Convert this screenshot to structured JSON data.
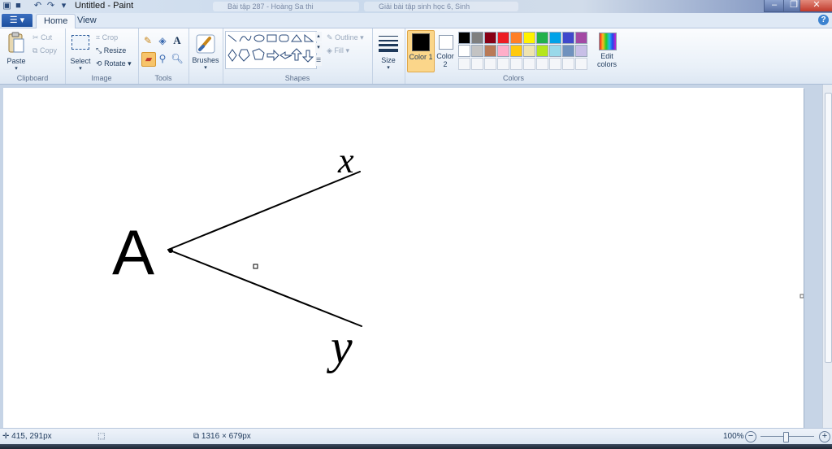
{
  "window": {
    "title": "Untitled - Paint",
    "background_tabs": [
      "Bài tập 287 - Hoàng Sa thi",
      "Giải bài tập sinh học 6, Sinh"
    ]
  },
  "tabs": {
    "home": "Home",
    "view": "View"
  },
  "ribbon": {
    "clipboard": {
      "label": "Clipboard",
      "paste": "Paste",
      "cut": "Cut",
      "copy": "Copy"
    },
    "image": {
      "label": "Image",
      "select": "Select",
      "crop": "Crop",
      "resize": "Resize",
      "rotate": "Rotate"
    },
    "tools": {
      "label": "Tools"
    },
    "brushes": {
      "label": "Brushes"
    },
    "shapes": {
      "label": "Shapes",
      "outline": "Outline",
      "fill": "Fill"
    },
    "size": {
      "label": "Size"
    },
    "colors": {
      "label": "Colors",
      "color1_label": "Color 1",
      "color2_label": "Color 2",
      "color1": "#000000",
      "color2": "#ffffff",
      "edit_label": "Edit colors",
      "palette_row1": [
        "#000000",
        "#7f7f7f",
        "#880015",
        "#ed1c24",
        "#ff7f27",
        "#fff200",
        "#22b14c",
        "#00a2e8",
        "#3f48cc",
        "#a349a4"
      ],
      "palette_row2": [
        "#ffffff",
        "#c3c3c3",
        "#b97a57",
        "#ffaec9",
        "#ffc90e",
        "#efe4b0",
        "#b5e61d",
        "#99d9ea",
        "#7092be",
        "#c8bfe7"
      ]
    }
  },
  "canvas": {
    "drawing": {
      "vertex_label": "A",
      "ray1_label": "x",
      "ray2_label": "y"
    }
  },
  "status": {
    "cursor_pos": "415, 291px",
    "image_size": "1316 × 679px",
    "zoom": "100%"
  }
}
